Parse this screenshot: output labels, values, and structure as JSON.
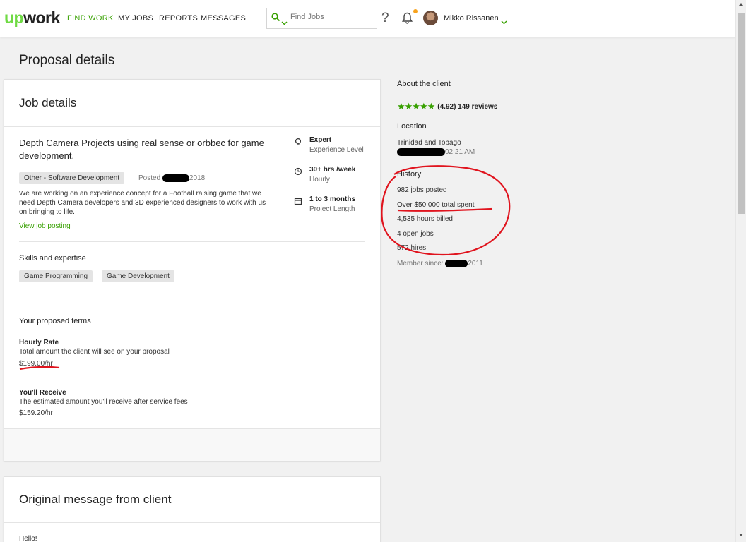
{
  "nav": {
    "logo": "upwork",
    "items": [
      "FIND WORK",
      "MY JOBS",
      "REPORTS",
      "MESSAGES"
    ],
    "search_placeholder": "Find Jobs",
    "help": "?",
    "user_name": "Mikko Rissanen"
  },
  "page": {
    "title": "Proposal details"
  },
  "job": {
    "card_title": "Job details",
    "title": "Depth Camera Projects using real sense or orbbec for game development.",
    "category": "Other - Software Development",
    "posted_label": "Posted",
    "posted_year": "2018",
    "description": "We are working on an experience concept for a Football raising game that we need Depth Camera developers and 3D experienced designers to work with us on bringing to life.",
    "view_link": "View job posting",
    "level": "Expert",
    "level_label": "Experience Level",
    "hours": "30+ hrs /week",
    "hours_label": "Hourly",
    "duration": "1 to 3 months",
    "duration_label": "Project Length",
    "skills_heading": "Skills and expertise",
    "skills": [
      "Game Programming",
      "Game Development"
    ],
    "terms_heading": "Your proposed terms",
    "rate_title": "Hourly Rate",
    "rate_desc": "Total amount the client will see on your proposal",
    "rate_value": "$199.00/hr",
    "receive_title": "You'll Receive",
    "receive_desc": "The estimated amount you'll receive after service fees",
    "receive_value": "$159.20/hr"
  },
  "client": {
    "about": "About the client",
    "stars": "★★★★★",
    "rating": "(4.92) 149 reviews",
    "location_heading": "Location",
    "country": "Trinidad and Tobago",
    "local_time": "02:21 AM",
    "history_heading": "History",
    "jobs_posted": "982 jobs posted",
    "total_spent": "Over $50,000 total spent",
    "hours_billed": "4,535 hours billed",
    "open_jobs": "4 open jobs",
    "hires": "572 hires",
    "member_since_label": "Member since:",
    "member_since_year": "2011"
  },
  "message": {
    "card_title": "Original message from client",
    "greeting": "Hello!"
  },
  "colors": {
    "brand_green": "#6fda44",
    "link_green": "#37a000",
    "annotation_red": "#e0141e"
  }
}
